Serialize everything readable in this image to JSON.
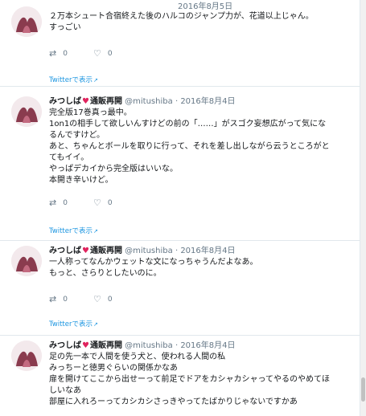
{
  "tweets": [
    {
      "name": "",
      "handle": "",
      "date": "2016年8月5日",
      "text": "２万本シュート合宿終えた後のハルコのジャンプ力が、花道以上じゃん。\nすっごい",
      "retweets": "0",
      "likes": "0",
      "view_link": "Twitterで表示"
    },
    {
      "name": "みつしば",
      "name_suffix": "通販再開",
      "handle": "@mitushiba",
      "date": "2016年8月4日",
      "text": "完全版17巻真っ最中。\n1on1の相手して欲しいんすけどの前の「……」がスゴク妄想広がって気にな\nるんですけど。\nあと、ちゃんとボールを取りに行って、それを差し出しながら云うところがと\nてもイイ。\nやっぱデカイから完全版はいいな。\n本開き辛いけど。",
      "retweets": "0",
      "likes": "0",
      "view_link": "Twitterで表示"
    },
    {
      "name": "みつしば",
      "name_suffix": "通販再開",
      "handle": "@mitushiba",
      "date": "2016年8月4日",
      "text": "一人称ってなんかウェットな文になっちゃうんだよなあ。\nもっと、さらりとしたいのに。",
      "retweets": "0",
      "likes": "0",
      "view_link": "Twitterで表示"
    },
    {
      "name": "みつしば",
      "name_suffix": "通販再開",
      "handle": "@mitushiba",
      "date": "2016年8月4日",
      "text": "足の先一本で人間を使う犬と、使われる人間の私\nみっちーと徳男ぐらいの関係かなあ\n扉を開けてここから出せーって前足でドアをカシャカシャってやるのやめてほ\nしいなあ\n部屋に入れろーってカシカシさっきやってたばかりじゃないですかあ"
    }
  ],
  "icons": {
    "retweet": "retweet-icon",
    "like": "heart-icon",
    "external": "external-link-icon"
  },
  "colors": {
    "link": "#1b95e0",
    "meta": "#657786",
    "heart": "#e0245e",
    "divider": "#e1e8ed"
  }
}
